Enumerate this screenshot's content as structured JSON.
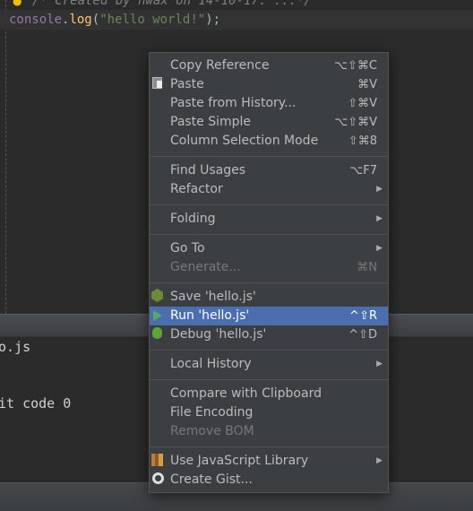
{
  "editor": {
    "comment_text": "/* Created by hwax on 14-10-17. ...*/",
    "code": {
      "object": "console",
      "dot": ".",
      "fn": "log",
      "open": "(",
      "string": "\"hello world!\"",
      "close": ");"
    }
  },
  "console": {
    "line1": "o.js",
    "line2": "it code 0"
  },
  "menu": {
    "items": [
      {
        "label": "Copy Reference",
        "shortcut": "⌥⇧⌘C"
      },
      {
        "label": "Paste",
        "shortcut": "⌘V",
        "icon": "paste-icon"
      },
      {
        "label": "Paste from History...",
        "shortcut": "⇧⌘V"
      },
      {
        "label": "Paste Simple",
        "shortcut": "⌥⇧⌘V"
      },
      {
        "label": "Column Selection Mode",
        "shortcut": "⇧⌘8"
      },
      {
        "label": "Find Usages",
        "shortcut": "⌥F7"
      },
      {
        "label": "Refactor",
        "submenu": true
      },
      {
        "label": "Folding",
        "submenu": true
      },
      {
        "label": "Go To",
        "submenu": true
      },
      {
        "label": "Generate...",
        "shortcut": "⌘N",
        "disabled": true
      },
      {
        "label": "Save 'hello.js'",
        "icon": "nodejs-icon"
      },
      {
        "label": "Run 'hello.js'",
        "shortcut": "^⇧R",
        "icon": "run-icon",
        "selected": true
      },
      {
        "label": "Debug 'hello.js'",
        "shortcut": "^⇧D",
        "icon": "debug-icon"
      },
      {
        "label": "Local History",
        "submenu": true
      },
      {
        "label": "Compare with Clipboard"
      },
      {
        "label": "File Encoding"
      },
      {
        "label": "Remove BOM",
        "disabled": true
      },
      {
        "label": "Use JavaScript Library",
        "submenu": true,
        "icon": "library-icon"
      },
      {
        "label": "Create Gist...",
        "icon": "github-icon"
      }
    ],
    "submenu_arrow": "▶"
  },
  "colors": {
    "selection": "#4b6eaf",
    "menu_bg": "#3c3f41",
    "editor_bg": "#2b2b2b"
  }
}
